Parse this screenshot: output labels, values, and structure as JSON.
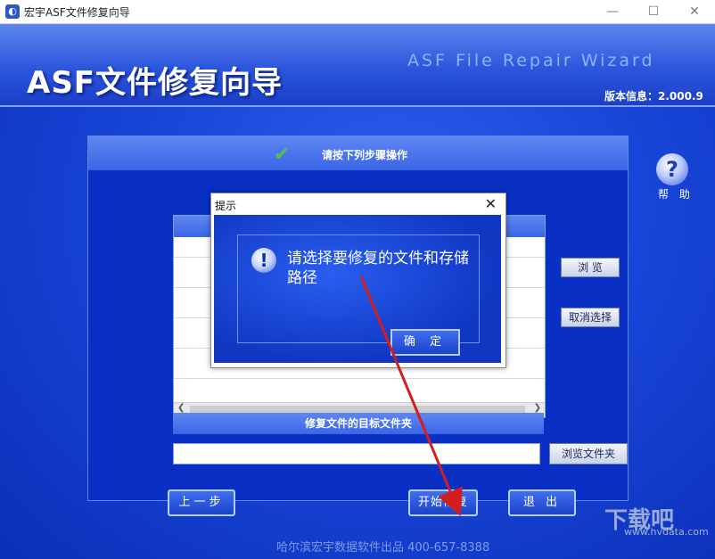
{
  "window": {
    "title": "宏宇ASF文件修复向导",
    "minimize": "—",
    "maximize": "☐",
    "close": "✕"
  },
  "header": {
    "logo": "ASF文件修复向导",
    "english": "ASF File Repair Wizard",
    "version": "版本信息：2.000.9"
  },
  "help": {
    "label": "帮 助",
    "icon": "?"
  },
  "panel": {
    "title": "请按下列步骤操作",
    "browse_label": "浏 览",
    "cancel_select_label": "取消选择",
    "target_label": "修复文件的目标文件夹",
    "target_value": "",
    "browse_folder_label": "浏览文件夹"
  },
  "buttons": {
    "prev": "上一步",
    "start": "开始修复",
    "exit": "退 出"
  },
  "footer": "哈尔滨宏宇数据软件出品  400-657-8388",
  "watermark": {
    "main": "下载吧",
    "sub": "www.hvdata.com"
  },
  "dialog": {
    "title": "提示",
    "message": "请选择要修复的文件和存储路径",
    "ok": "确 定"
  }
}
